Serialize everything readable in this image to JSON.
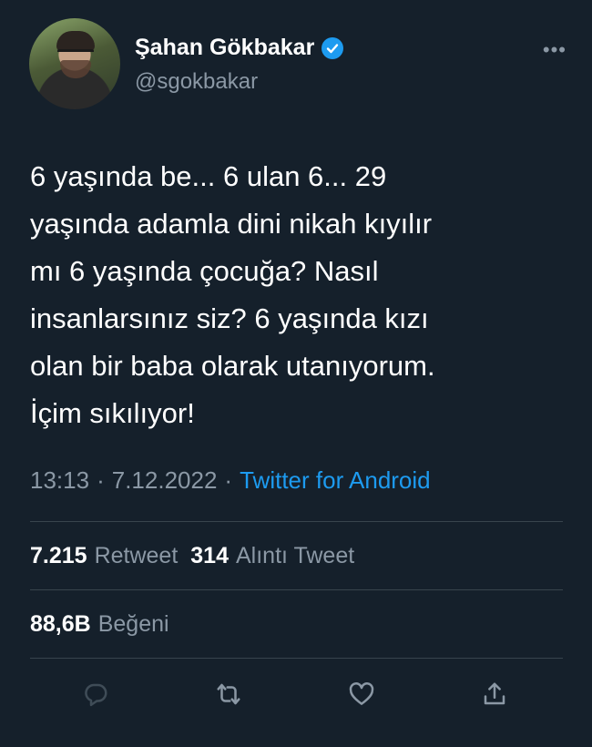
{
  "author": {
    "display_name": "Şahan Gökbakar",
    "handle": "@sgokbakar",
    "verified_icon": "verified-badge-icon",
    "avatar_icon": "avatar"
  },
  "more_label": "•••",
  "tweet": {
    "text": "6 yaşında be... 6 ulan 6... 29\nyaşında adamla dini nikah kıyılır\nmı 6 yaşında çocuğa? Nasıl\ninsanlarsınız siz? 6 yaşında kızı\nolan bir baba olarak utanıyorum.\nİçim sıkılıyor!",
    "time": "13:13",
    "separator1": "·",
    "date": "7.12.2022",
    "separator2": "·",
    "source": "Twitter for Android"
  },
  "stats": {
    "retweets_count": "7.215",
    "retweets_label": "Retweet",
    "quotes_count": "314",
    "quotes_label": "Alıntı Tweet",
    "likes_count": "88,6B",
    "likes_label": "Beğeni"
  },
  "actions": [
    {
      "name": "reply",
      "icon": "reply-icon"
    },
    {
      "name": "retweet",
      "icon": "retweet-icon"
    },
    {
      "name": "like",
      "icon": "heart-icon"
    },
    {
      "name": "share",
      "icon": "share-icon"
    }
  ],
  "colors": {
    "background": "#15202b",
    "text": "#ffffff",
    "muted": "#8b98a5",
    "accent": "#1d9bf0",
    "divider": "#38444d",
    "icon": "#8b98a5"
  }
}
